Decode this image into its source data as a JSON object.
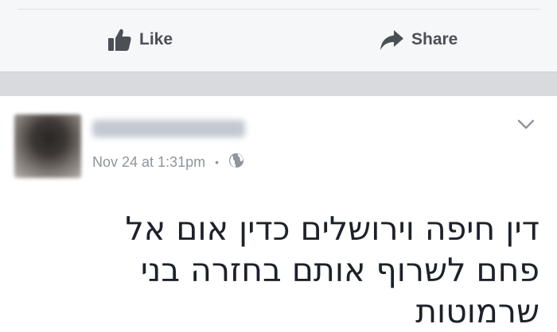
{
  "actions": {
    "like": {
      "label": "Like",
      "icon": "thumbs-up-icon"
    },
    "share": {
      "label": "Share",
      "icon": "share-arrow-icon"
    }
  },
  "post": {
    "author_name": "",
    "timestamp": "Nov 24 at 1:31pm",
    "separator": "•",
    "privacy_icon": "globe-icon",
    "menu_icon": "chevron-down-icon",
    "text": "דין חיפה וירושלים כדין אום אל פחם לשרוף אותם בחזרה בני שרמוטות"
  },
  "colors": {
    "action_text": "#4b4f56",
    "meta_text": "#90949c",
    "body_text": "#1d2129",
    "band": "#d9dadd",
    "bar_bg": "#f6f7f9"
  }
}
